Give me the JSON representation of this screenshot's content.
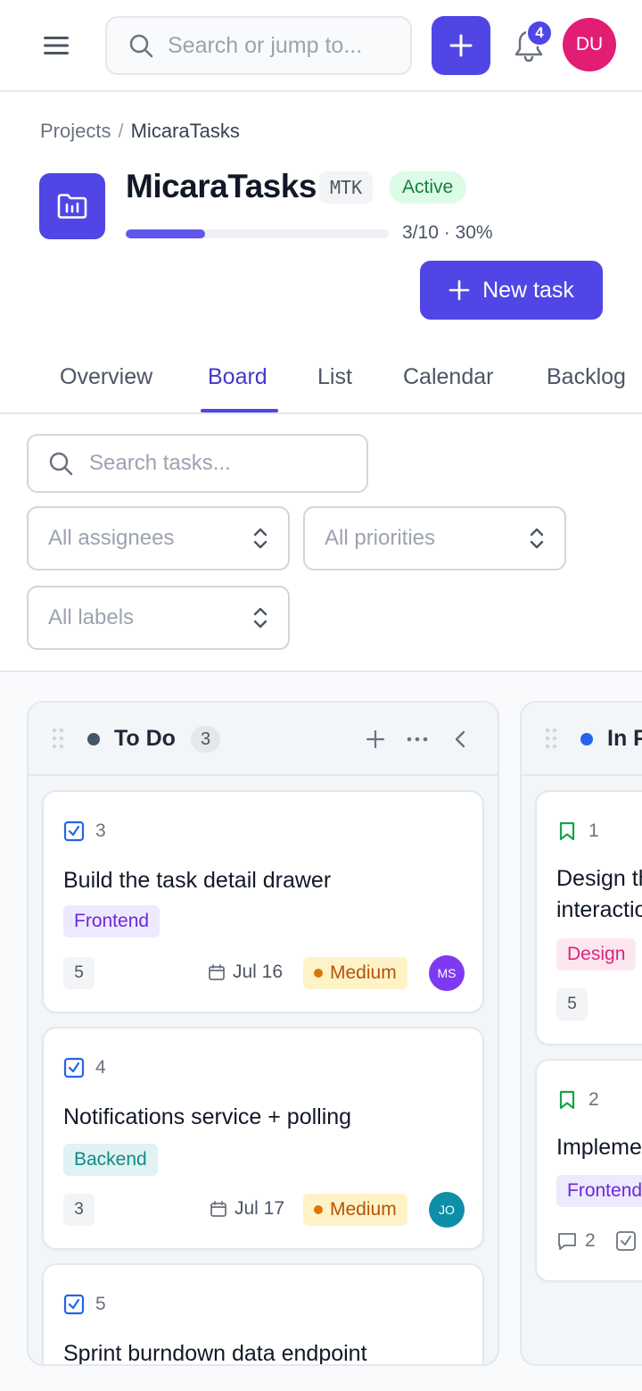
{
  "topbar": {
    "search_placeholder": "Search or jump to...",
    "notification_count": "4",
    "user_initials": "DU"
  },
  "breadcrumb": {
    "parent": "Projects",
    "separator": "/",
    "current": "MicaraTasks"
  },
  "project": {
    "name": "MicaraTasks",
    "key": "MTK",
    "status": "Active",
    "progress_text": "3/10 · 30%",
    "progress_fraction": 0.3,
    "new_task_label": "New task"
  },
  "tabs": [
    {
      "label": "Overview"
    },
    {
      "label": "Board"
    },
    {
      "label": "List"
    },
    {
      "label": "Calendar"
    },
    {
      "label": "Backlog"
    }
  ],
  "active_tab": "Board",
  "filters": {
    "search_placeholder": "Search tasks...",
    "assignees": "All assignees",
    "priorities": "All priorities",
    "labels": "All labels"
  },
  "board": {
    "columns": [
      {
        "name": "To Do",
        "count": "3",
        "dot_color": "#475569",
        "cards": [
          {
            "number": "3",
            "title": "Build the task detail drawer",
            "label": "Frontend",
            "points": "5",
            "due": "Jul 16",
            "priority": "Medium",
            "assignee": "MS",
            "assignee_color": "#7e3af2"
          },
          {
            "number": "4",
            "title": "Notifications service + polling",
            "label": "Backend",
            "points": "3",
            "due": "Jul 17",
            "priority": "Medium",
            "assignee": "JO",
            "assignee_color": "#0e8fa8"
          },
          {
            "number": "5",
            "title": "Sprint burndown data endpoint"
          }
        ]
      },
      {
        "name": "In Progress",
        "dot_color": "#2563eb",
        "cards": [
          {
            "number": "1",
            "title_line1": "Design the",
            "title_line2": "interactions",
            "label": "Design",
            "points": "5"
          },
          {
            "number": "2",
            "title": "Implement",
            "label": "Frontend",
            "comments": "2"
          }
        ]
      }
    ]
  },
  "colors": {
    "accent": "#4f46e5",
    "frontend_label_bg": "#ede9fe",
    "frontend_label_fg": "#6d28d9",
    "backend_label_bg": "#e0f2f1",
    "backend_label_fg": "#0f8a8a",
    "design_label_bg": "#fce7f0",
    "design_label_fg": "#db2777",
    "medium_priority_bg": "#fef3c7"
  }
}
